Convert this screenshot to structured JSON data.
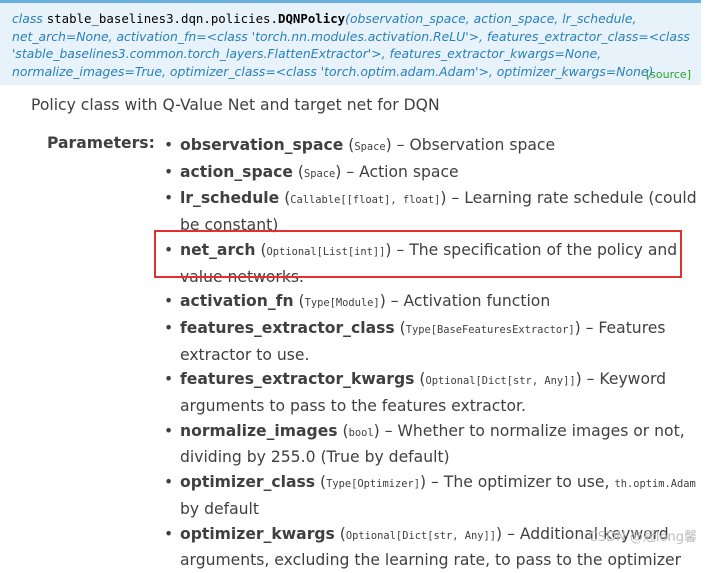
{
  "signature": {
    "keyword": "class",
    "module": "stable_baselines3.dqn.policies.",
    "classname": "DQNPolicy",
    "args_line1": "(observation_space, action_space, lr_schedule,",
    "args_line2": "net_arch=None, activation_fn=<class 'torch.nn.modules.activation.ReLU'>, features_extractor_class=<class",
    "args_line3": "'stable_baselines3.common.torch_layers.FlattenExtractor'>, features_extractor_kwargs=None,",
    "args_line4": "normalize_images=True, optimizer_class=<class 'torch.optim.adam.Adam'>, optimizer_kwargs=None)",
    "source_link": "[source]"
  },
  "description": "Policy class with Q-Value Net and target net for DQN",
  "parameters_label": "Parameters:",
  "params": [
    {
      "name": "observation_space",
      "type": "Space",
      "text": " – Observation space"
    },
    {
      "name": "action_space",
      "type": "Space",
      "text": " – Action space"
    },
    {
      "name": "lr_schedule",
      "type": "Callable[[float], float]",
      "text": " – Learning rate schedule (could be constant)"
    },
    {
      "name": "net_arch",
      "type": "Optional[List[int]]",
      "text": " – The specification of the policy and value networks."
    },
    {
      "name": "activation_fn",
      "type": "Type[Module]",
      "text": " – Activation function"
    },
    {
      "name": "features_extractor_class",
      "type": "Type[BaseFeaturesExtractor]",
      "text": " – Features extractor to use."
    },
    {
      "name": "features_extractor_kwargs",
      "type": "Optional[Dict[str, Any]]",
      "text": " – Keyword arguments to pass to the features extractor."
    },
    {
      "name": "normalize_images",
      "type": "bool",
      "text": " – Whether to normalize images or not, dividing by 255.0 (True by default)"
    },
    {
      "name": "optimizer_class",
      "type": "Type[Optimizer]",
      "text": " – The optimizer to use, ",
      "code_after": "th.optim.Adam",
      "text_after": " by default"
    },
    {
      "name": "optimizer_kwargs",
      "type": "Optional[Dict[str, Any]]",
      "text": " – Additional keyword arguments, excluding the learning rate, to pass to the optimizer"
    }
  ],
  "watermark": "CSDN @冠long馨"
}
